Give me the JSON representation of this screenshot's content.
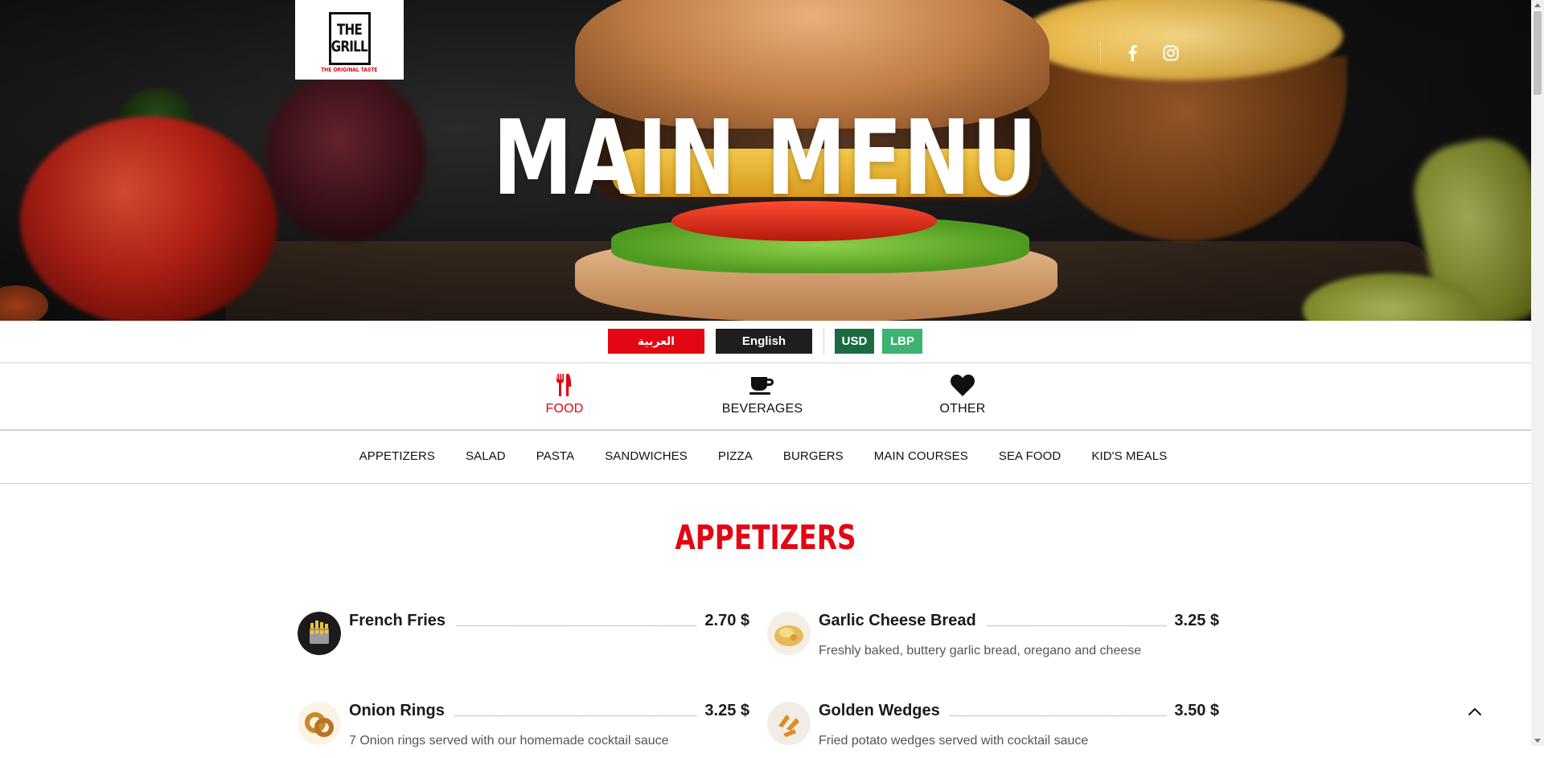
{
  "brand": {
    "logo_line1": "THE",
    "logo_line2": "GRILL",
    "logo_tagline": "THE ORIGINAL TASTE",
    "accent_color": "#e30613"
  },
  "hero": {
    "title": "MAIN MENU",
    "social": [
      {
        "icon": "facebook-icon"
      },
      {
        "icon": "instagram-icon"
      }
    ]
  },
  "language": {
    "arabic": "العربية",
    "english": "English"
  },
  "currency": {
    "usd": "USD",
    "lbp": "LBP",
    "usd_color": "#1c6a40",
    "lbp_color": "#3cb371"
  },
  "categories": [
    {
      "label": "FOOD",
      "icon": "utensils-icon",
      "active": true
    },
    {
      "label": "BEVERAGES",
      "icon": "coffee-cup-icon",
      "active": false
    },
    {
      "label": "OTHER",
      "icon": "heart-icon",
      "active": false
    }
  ],
  "subnav": [
    "APPETIZERS",
    "SALAD",
    "PASTA",
    "SANDWICHES",
    "PIZZA",
    "BURGERS",
    "MAIN COURSES",
    "SEA FOOD",
    "KID'S MEALS"
  ],
  "section": {
    "title": "APPETIZERS",
    "items": [
      {
        "name": "French Fries",
        "price": "2.70 $",
        "description": ""
      },
      {
        "name": "Garlic Cheese Bread",
        "price": "3.25 $",
        "description": "Freshly baked, buttery garlic bread, oregano and cheese"
      },
      {
        "name": "Onion Rings",
        "price": "3.25 $",
        "description": "7 Onion rings served with our homemade cocktail sauce"
      },
      {
        "name": "Golden Wedges",
        "price": "3.50 $",
        "description": "Fried potato wedges served with cocktail sauce"
      }
    ]
  }
}
